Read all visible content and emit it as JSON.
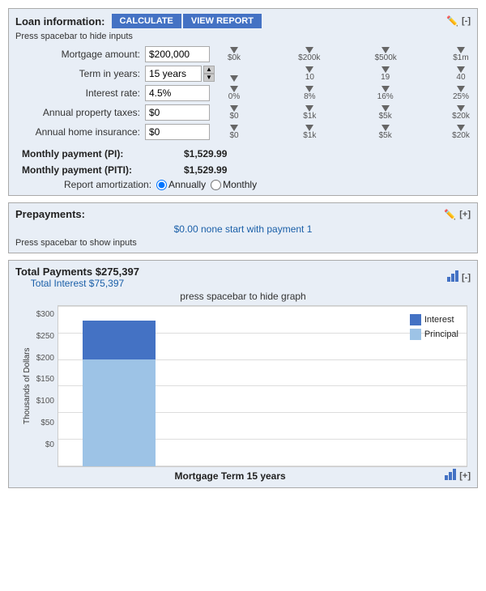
{
  "loan": {
    "section_title": "Loan information:",
    "calculate_label": "CALCULATE",
    "view_report_label": "VIEW REPORT",
    "hide_hint": "Press spacebar to hide inputs",
    "mortgage_label": "Mortgage amount:",
    "mortgage_value": "$200,000",
    "mortgage_ticks": [
      "$0k",
      "$200k",
      "$500k",
      "$1m"
    ],
    "term_label": "Term in years:",
    "term_value": "15 years",
    "term_ticks": [
      "",
      "10",
      "19",
      "40"
    ],
    "rate_label": "Interest rate:",
    "rate_value": "4.5%",
    "rate_ticks": [
      "0%",
      "8%",
      "16%",
      "25%"
    ],
    "tax_label": "Annual property taxes:",
    "tax_value": "$0",
    "tax_ticks": [
      "$0",
      "$1k",
      "$5k",
      "$20k"
    ],
    "insurance_label": "Annual home insurance:",
    "insurance_value": "$0",
    "insurance_ticks": [
      "$0",
      "$1k",
      "$5k",
      "$20k"
    ],
    "payment_pi_label": "Monthly payment (PI):",
    "payment_pi_value": "$1,529.99",
    "payment_piti_label": "Monthly payment (PITI):",
    "payment_piti_value": "$1,529.99",
    "amort_label": "Report amortization:",
    "amort_annually": "Annually",
    "amort_monthly": "Monthly"
  },
  "prepayments": {
    "section_title": "Prepayments:",
    "info_text": "$0.00 none start with payment 1",
    "show_hint": "Press spacebar to show inputs"
  },
  "chart": {
    "section_title": "Total Payments $275,397",
    "section_subtitle": "Total Interest $75,397",
    "hint": "press spacebar to hide graph",
    "y_label": "Thousands of Dollars",
    "y_axis": [
      "$300",
      "$250",
      "$200",
      "$150",
      "$100",
      "$50",
      "$0"
    ],
    "x_label": "Mortgage Term 15 years",
    "legend_interest": "Interest",
    "legend_principal": "Principal",
    "bar_total_height": 180,
    "bar_interest_pct": 27,
    "bar_principal_pct": 73,
    "colors": {
      "interest": "#4472c4",
      "principal": "#9dc3e6"
    }
  }
}
